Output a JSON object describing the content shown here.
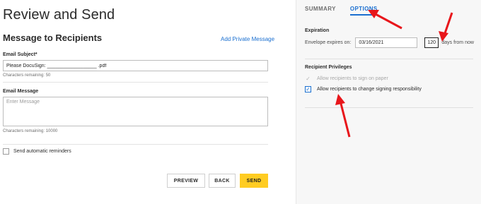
{
  "page": {
    "title": "Review and Send"
  },
  "message": {
    "section_title": "Message to Recipients",
    "add_private_link": "Add Private Message",
    "subject_label": "Email Subject*",
    "subject_value": "Please DocuSign: __________________ .pdf",
    "subject_helper": "Characters remaining: 50",
    "message_label": "Email Message",
    "message_placeholder": "Enter Message",
    "message_helper": "Characters remaining: 10000",
    "reminder_label": "Send automatic reminders"
  },
  "actions": {
    "preview": "PREVIEW",
    "back": "BACK",
    "send": "SEND"
  },
  "panel": {
    "tabs": [
      {
        "label": "SUMMARY",
        "active": false
      },
      {
        "label": "OPTIONS",
        "active": true
      }
    ],
    "expiration_heading": "Expiration",
    "expiration_label": "Envelope expires on:",
    "expiration_date": "03/16/2021",
    "days_value": "120",
    "days_suffix": "days from now",
    "privileges_heading": "Recipient Privileges",
    "privilege_1": "Allow recipients to sign on paper",
    "privilege_2": "Allow recipients to change signing responsibility"
  },
  "icons": {
    "check": "check-icon",
    "annotation": "red-arrow-icon"
  },
  "colors": {
    "accent": "#1a6fd0",
    "send": "#ffcc22",
    "annotation": "#e8161b"
  }
}
